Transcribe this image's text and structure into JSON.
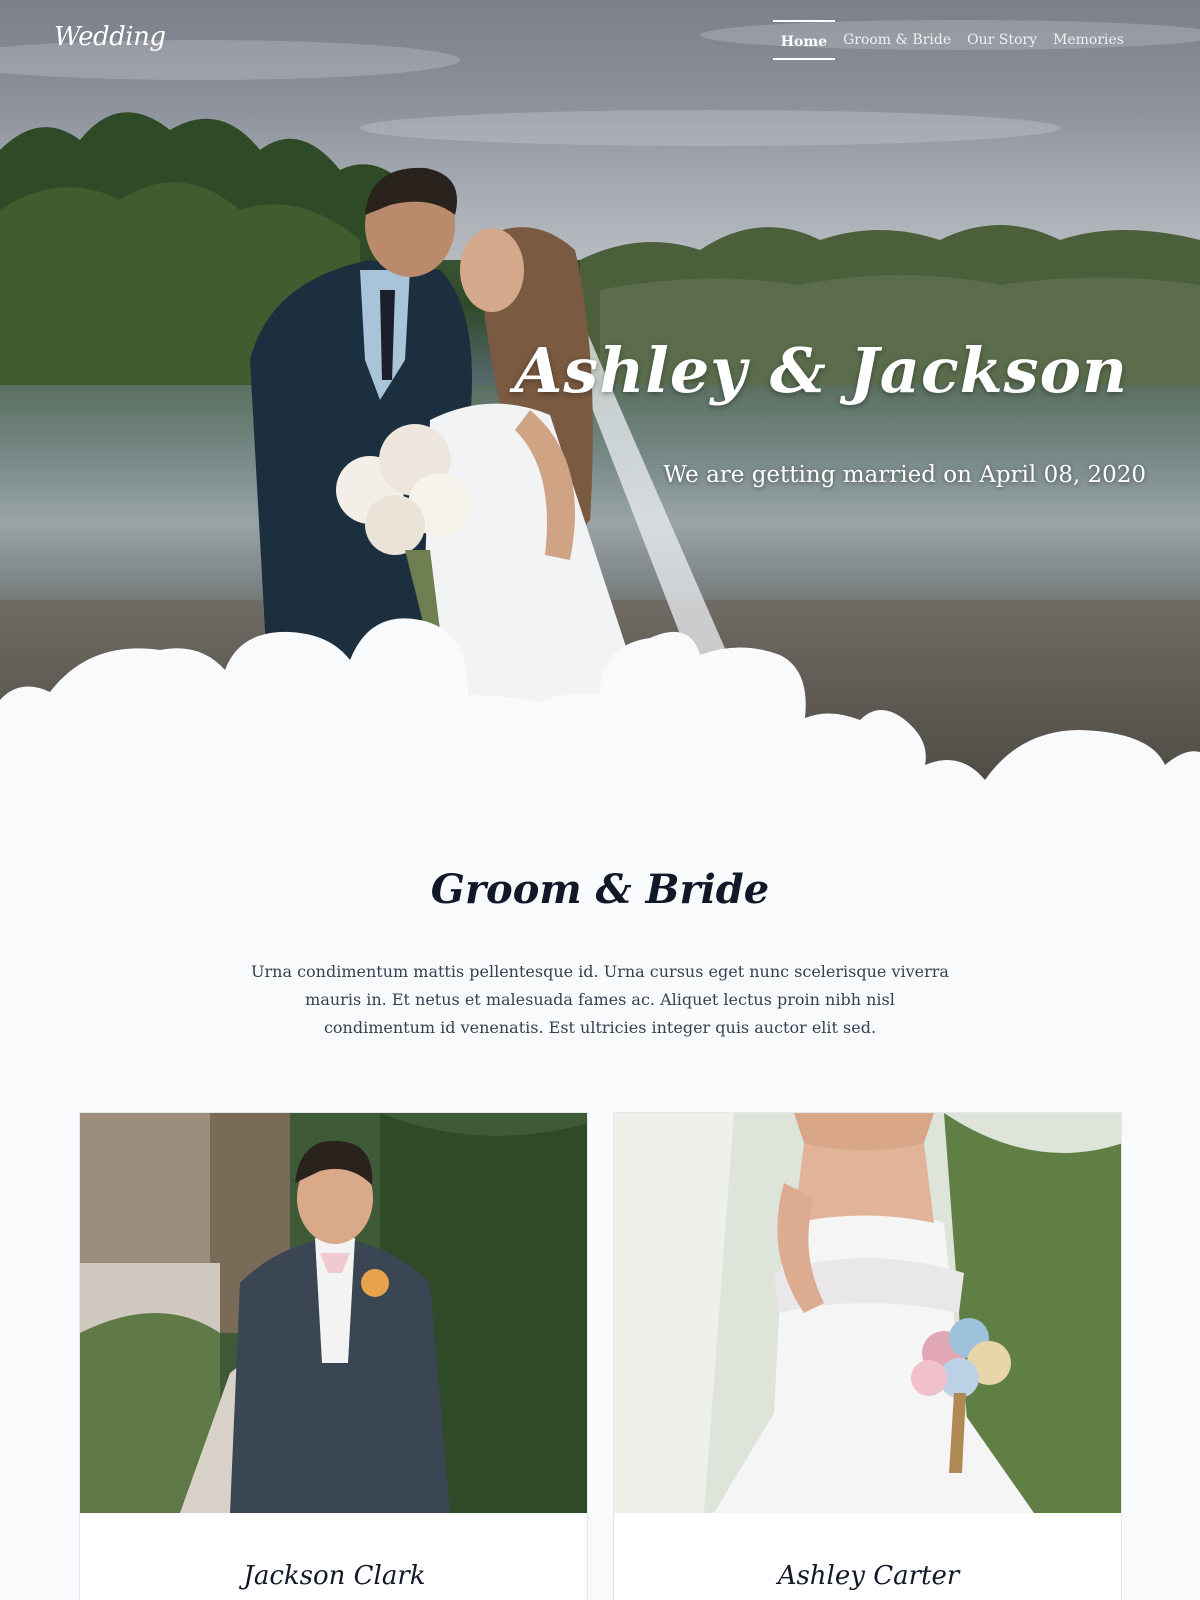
{
  "site": {
    "logo": "Wedding"
  },
  "nav": {
    "items": [
      {
        "label": "Home",
        "active": true
      },
      {
        "label": "Groom & Bride",
        "active": false
      },
      {
        "label": "Our Story",
        "active": false
      },
      {
        "label": "Memories",
        "active": false
      }
    ]
  },
  "hero": {
    "title": "Ashley & Jackson",
    "subtitle": "We are getting married on April 08, 2020"
  },
  "couple_section": {
    "title": "Groom & Bride",
    "text": "Urna condimentum mattis pellentesque id. Urna cursus eget nunc scelerisque viverra mauris in. Et netus et malesuada fames ac. Aliquet lectus proin nibh nisl condimentum id venenatis. Est ultricies integer quis auctor elit sed.",
    "groom": {
      "name": "Jackson Clark"
    },
    "bride": {
      "name": "Ashley Carter"
    }
  },
  "colors": {
    "page_bg": "#f8fafc",
    "hero_text": "#ffffff",
    "heading": "#111827",
    "body_text": "#374151"
  }
}
